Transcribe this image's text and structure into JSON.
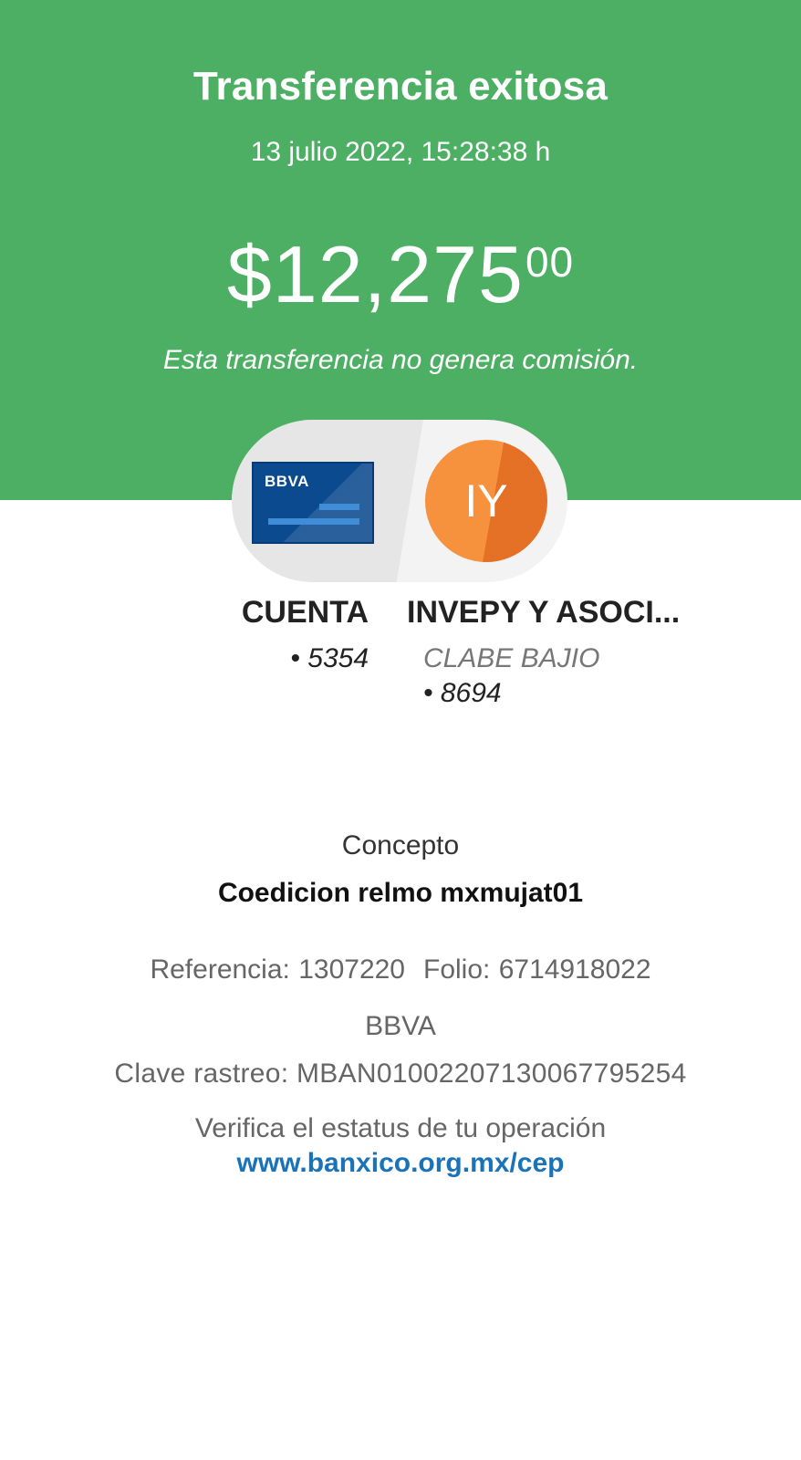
{
  "header": {
    "title": "Transferencia exitosa",
    "datetime": "13 julio 2022, 15:28:38 h",
    "amount_main": "$12,275",
    "amount_cents": "00",
    "fee_note": "Esta transferencia no genera comisión."
  },
  "origin": {
    "icon": "bank-card-icon",
    "bank_logo": "BBVA",
    "name": "CUENTA",
    "number": "• 5354"
  },
  "destination": {
    "initials": "IY",
    "name": "INVEPY Y ASOCI...",
    "type": "CLABE BAJIO",
    "number": "• 8694"
  },
  "details": {
    "concept_label": "Concepto",
    "concept_value": "Coedicion relmo mxmujat01",
    "reference": "Referencia: 1307220",
    "folio": "Folio: 6714918022",
    "bank": "BBVA",
    "tracking_key": "Clave rastreo: MBAN01002207130067795254",
    "verify_text": "Verifica el estatus de tu operación",
    "verify_link": "www.banxico.org.mx/cep"
  },
  "colors": {
    "header_green": "#4caf63",
    "card_blue": "#0b4a8f",
    "avatar_orange": "#f6913e",
    "link_blue": "#1a73b9"
  }
}
